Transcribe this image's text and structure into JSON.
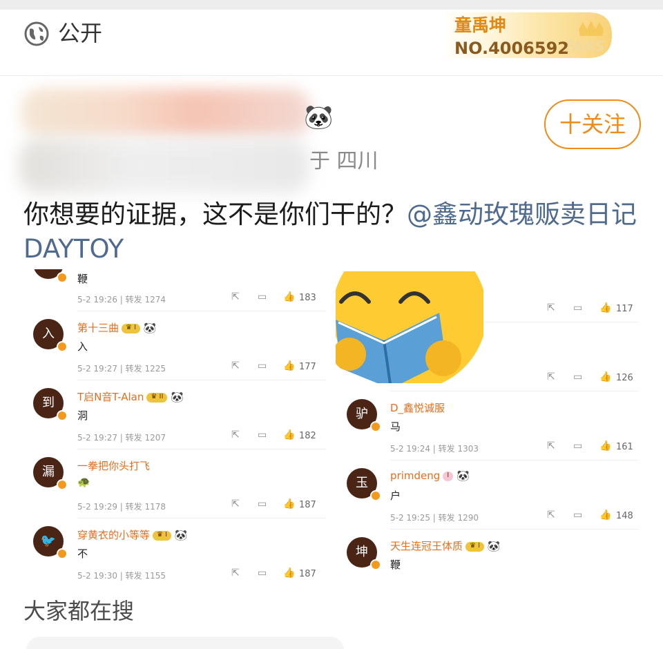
{
  "header": {
    "visibility_icon": "globe-icon",
    "visibility_label": "公开",
    "fans_badge": {
      "name": "童禹坤",
      "number": "NO.4006592",
      "tag": "FANS"
    }
  },
  "author": {
    "panda_emoji": "🐼",
    "location": "于 四川",
    "follow_label": "十关注"
  },
  "post": {
    "text": "你想要的证据，这不是你们干的？",
    "mention": "@鑫动玫瑰贩卖日记DAYTOY"
  },
  "embedded": {
    "left_comments": [
      {
        "avatar": "",
        "name": "",
        "text": "鞭",
        "meta": "5-2 19:26 | 转发 1274",
        "likes": "183"
      },
      {
        "avatar": "入",
        "name": "第十三曲",
        "text": "入",
        "meta": "5-2 19:27 | 转发 1225",
        "likes": "177"
      },
      {
        "avatar": "到",
        "name": "T启N音T-Alan",
        "text": "洞",
        "meta": "5-2 19:27 | 转发 1207",
        "likes": "182"
      },
      {
        "avatar": "漏",
        "name": "一拳把你头打飞",
        "text": "🐢",
        "meta": "5-2 19:29 | 转发 1178",
        "likes": "187"
      },
      {
        "avatar": "🐦",
        "name": "穿黄衣的小等等",
        "text": "不",
        "meta": "5-2 19:30 | 转发 1155",
        "likes": "187"
      }
    ],
    "right_comments": [
      {
        "avatar": "",
        "name": "",
        "text": "",
        "meta": "",
        "likes": "117"
      },
      {
        "avatar": "",
        "name": "",
        "text": "",
        "meta": "",
        "likes": "126"
      },
      {
        "avatar": "驴",
        "name": "D_鑫悦诚服",
        "text": "马",
        "meta": "5-2 19:24 | 转发 1303",
        "likes": "161"
      },
      {
        "avatar": "玉",
        "name": "primdeng",
        "text": "户",
        "meta": "5-2 19:25 | 转发 1290",
        "likes": "148"
      },
      {
        "avatar": "坤",
        "name": "天生连冠王体质",
        "text": "鞭",
        "meta": "",
        "likes": ""
      }
    ],
    "overlay_emoji": "reading-book-emoji"
  },
  "bottom": {
    "search_title": "大家都在搜"
  },
  "colors": {
    "accent": "#f08a19",
    "mention": "#4e6a8f",
    "username": "#e96d1a"
  }
}
